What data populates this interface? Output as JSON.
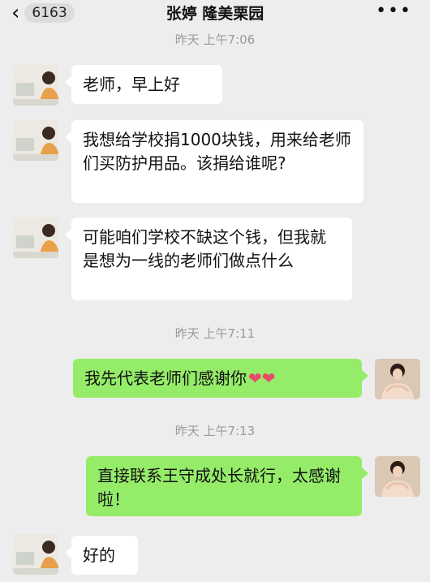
{
  "header": {
    "back_icon": "chevron-left-icon",
    "unread_count": "6163",
    "title": "张婷 隆美栗园",
    "more_icon": "ellipsis-icon"
  },
  "messages": {
    "time1": "昨天 上午7:06",
    "msg1": "老师，早上好",
    "msg2": "我想给学校捐1000块钱，用来给老师们买防护用品。该捐给谁呢?",
    "msg3": "可能咱们学校不缺这个钱，但我就是想为一线的老师们做点什么",
    "time2": "昨天 上午7:11",
    "msg4": "我先代表老师们感谢你",
    "msg4_emoji": "❤❤",
    "time3": "昨天 上午7:13",
    "msg5": "直接联系王守成处长就行，太感谢啦！",
    "msg6": "好的"
  },
  "colors": {
    "background": "#ededed",
    "bubble_left": "#ffffff",
    "bubble_right": "#95ec69",
    "timestamp": "#9a9a9a"
  }
}
